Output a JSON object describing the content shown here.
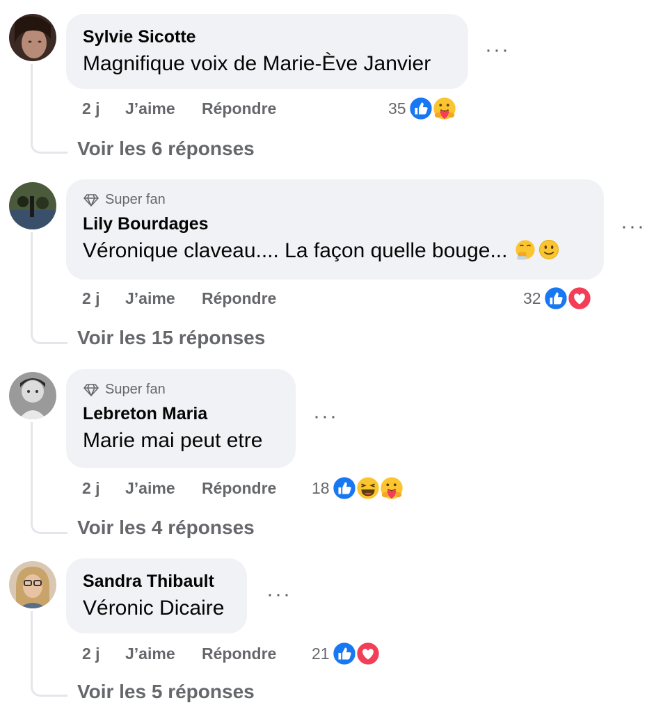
{
  "comments": [
    {
      "author": "Sylvie Sicotte",
      "badge": null,
      "text": "Magnifique voix de Marie-Ève Janvier",
      "time": "2 j",
      "like": "J’aime",
      "reply": "Répondre",
      "reaction_count": "35",
      "reactions": [
        "like",
        "care"
      ],
      "view_replies": "Voir les 6 réponses"
    },
    {
      "author": "Lily Bourdages",
      "badge": "Super fan",
      "text": "Véronique claveau.... La façon quelle bouge...",
      "text_emojis": [
        "face-with-hand-over-mouth",
        "slightly-smiling-face"
      ],
      "time": "2 j",
      "like": "J’aime",
      "reply": "Répondre",
      "reaction_count": "32",
      "reactions": [
        "like",
        "love"
      ],
      "view_replies": "Voir les 15 réponses"
    },
    {
      "author": "Lebreton Maria",
      "badge": "Super fan",
      "text": "Marie mai peut etre",
      "time": "2 j",
      "like": "J’aime",
      "reply": "Répondre",
      "reaction_count": "18",
      "reactions": [
        "like",
        "haha",
        "care"
      ],
      "view_replies": "Voir les 4 réponses"
    },
    {
      "author": "Sandra Thibault",
      "badge": null,
      "text": "Véronic Dicaire",
      "time": "2 j",
      "like": "J’aime",
      "reply": "Répondre",
      "reaction_count": "21",
      "reactions": [
        "like",
        "love"
      ],
      "view_replies": "Voir les 5 réponses"
    }
  ],
  "more_label": "···",
  "colors": {
    "bubble": "#f0f2f5",
    "secondary_text": "#65676b",
    "like_blue": "#1877f2",
    "love_red": "#f33e58",
    "emoji_yellow": "#fbc531"
  }
}
